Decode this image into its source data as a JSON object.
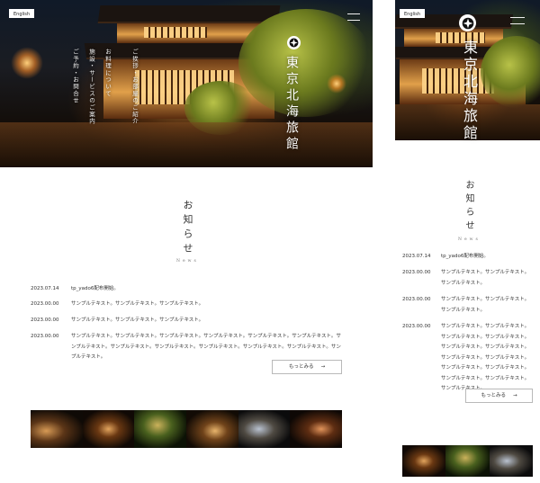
{
  "site": {
    "lang_label": "English",
    "brand": "東京北海旅館",
    "crest_icon": "kamon-crest-icon"
  },
  "nav": [
    {
      "label": "ご挨拶・お部屋のご紹介"
    },
    {
      "label": "お料理について"
    },
    {
      "label": "施設・サービスのご案内"
    },
    {
      "label": "ご予約・お問合せ"
    }
  ],
  "news": {
    "title": "お知らせ",
    "subtitle": "News",
    "items": [
      {
        "date": "2023.07.14",
        "text": "tp_yado6配布開始。"
      },
      {
        "date": "2023.00.00",
        "text": "サンプルテキスト。サンプルテキスト。サンプルテキスト。"
      },
      {
        "date": "2023.00.00",
        "text": "サンプルテキスト。サンプルテキスト。サンプルテキスト。"
      },
      {
        "date": "2023.00.00",
        "text": "サンプルテキスト。サンプルテキスト。サンプルテキスト。サンプルテキスト。サンプルテキスト。サンプルテキスト。サンプルテキスト。サンプルテキスト。サンプルテキスト。サンプルテキスト。サンプルテキスト。サンプルテキスト。サンプルテキスト。"
      }
    ],
    "more_label": "もっとみる",
    "more_arrow": "→"
  },
  "colors": {
    "background": "#ffffff",
    "text": "#2a2a2a",
    "button_border": "#b9b9b9"
  }
}
